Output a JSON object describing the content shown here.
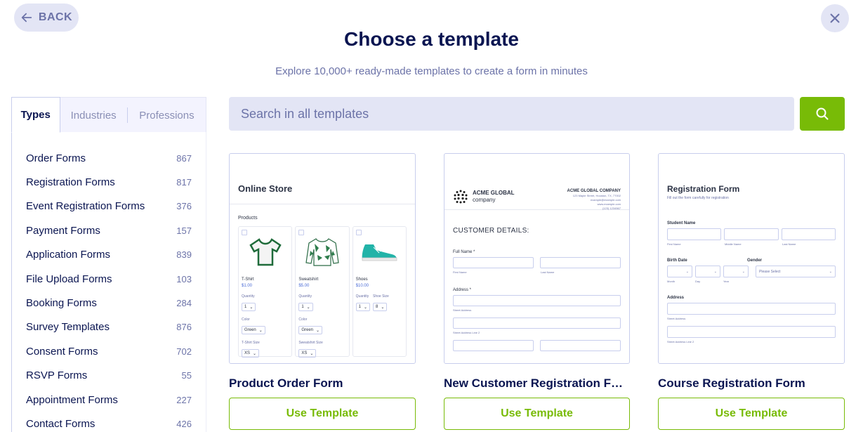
{
  "header": {
    "back_label": "BACK",
    "title": "Choose a template",
    "subtitle": "Explore 10,000+ ready-made templates to create a form in minutes"
  },
  "tabs": [
    {
      "label": "Types",
      "active": true
    },
    {
      "label": "Industries",
      "active": false
    },
    {
      "label": "Professions",
      "active": false
    }
  ],
  "categories": [
    {
      "name": "Order Forms",
      "count": "867"
    },
    {
      "name": "Registration Forms",
      "count": "817"
    },
    {
      "name": "Event Registration Forms",
      "count": "376"
    },
    {
      "name": "Payment Forms",
      "count": "157"
    },
    {
      "name": "Application Forms",
      "count": "839"
    },
    {
      "name": "File Upload Forms",
      "count": "103"
    },
    {
      "name": "Booking Forms",
      "count": "284"
    },
    {
      "name": "Survey Templates",
      "count": "876"
    },
    {
      "name": "Consent Forms",
      "count": "702"
    },
    {
      "name": "RSVP Forms",
      "count": "55"
    },
    {
      "name": "Appointment Forms",
      "count": "227"
    },
    {
      "name": "Contact Forms",
      "count": "426"
    }
  ],
  "search": {
    "placeholder": "Search in all templates",
    "value": ""
  },
  "colors": {
    "accent_green": "#78bb07",
    "navy": "#0a1551",
    "muted": "#6c73a8",
    "field_bg": "#e3e5f5"
  },
  "templates": [
    {
      "title": "Product Order Form",
      "button": "Use Template",
      "preview": {
        "heading": "Online Store",
        "section": "Products",
        "products": [
          {
            "name": "T-Shirt",
            "price": "$1.00",
            "qty_label": "Quantity",
            "qty": "1",
            "color_label": "Color",
            "color": "Green",
            "size_label": "T-Shirt Size",
            "size": "XS"
          },
          {
            "name": "Sweatshirt",
            "price": "$5.00",
            "qty_label": "Quantity",
            "qty": "1",
            "color_label": "Color",
            "color": "Green",
            "size_label": "Sweatshirt Size",
            "size": "XS"
          },
          {
            "name": "Shoes",
            "price": "$10.00",
            "qty_label": "Quantity",
            "qty": "1",
            "size_label": "Shoe Size",
            "size": "8"
          }
        ]
      }
    },
    {
      "title": "New Customer Registration Form",
      "button": "Use Template",
      "preview": {
        "logo_line1": "ACME GLOBAL",
        "logo_line2": "company",
        "company": "ACME GLOBAL COMPANY",
        "address": "123 Maple Street, Houston, TX, 77002",
        "email": "example@example.com",
        "website": "www.example.com",
        "phone": "(123) 1234567",
        "section": "CUSTOMER DETAILS:",
        "full_name_label": "Full Name *",
        "first_name": "First Name",
        "last_name": "Last Name",
        "address_label": "Address *",
        "street": "Street Address",
        "street2": "Street Address Line 2"
      }
    },
    {
      "title": "Course Registration Form",
      "button": "Use Template",
      "preview": {
        "heading": "Registration Form",
        "subheading": "Fill out the form carefully for registration",
        "student_label": "Student Name",
        "first": "First Name",
        "middle": "Middle Name",
        "last": "Last Name",
        "birth_label": "Birth Date",
        "gender_label": "Gender",
        "gender_placeholder": "Please Select",
        "month": "Month",
        "day": "Day",
        "year": "Year",
        "address_label": "Address",
        "street": "Street Address",
        "street2": "Street Address Line 2"
      }
    }
  ]
}
